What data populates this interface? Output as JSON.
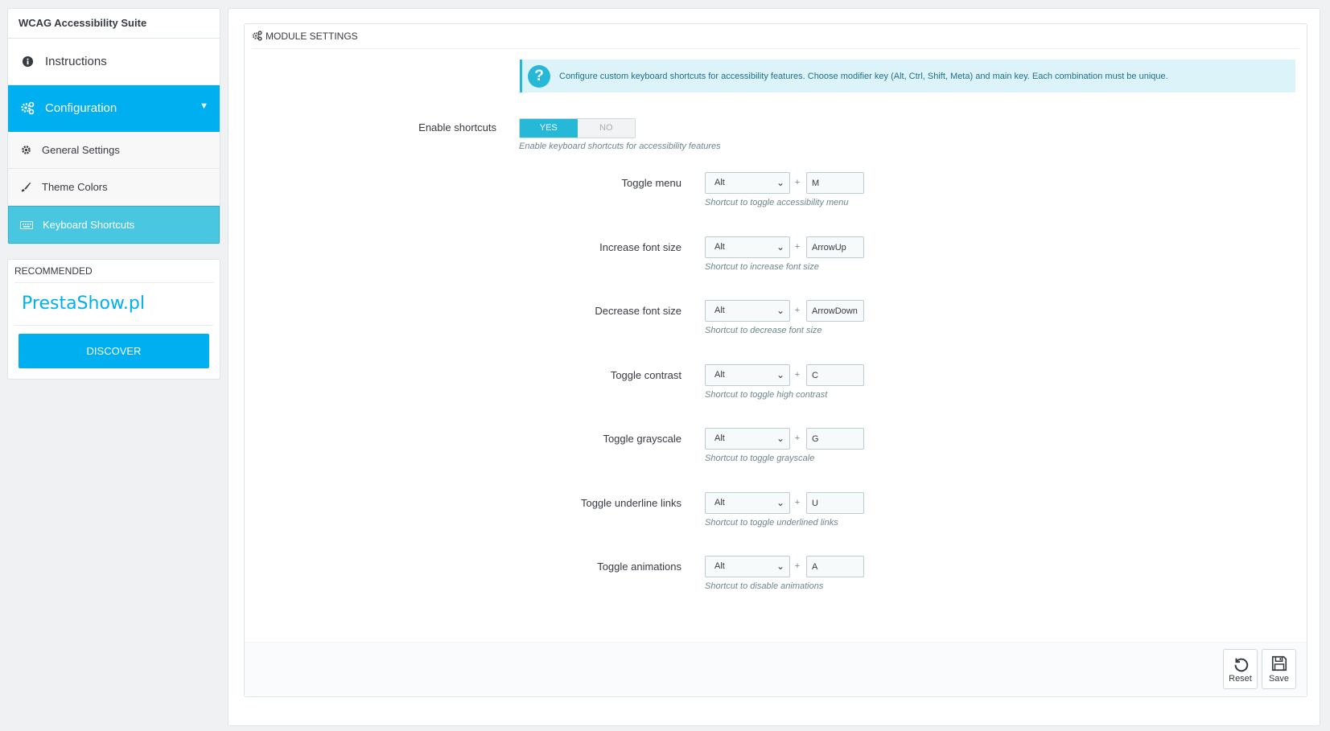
{
  "sidebar": {
    "title": "WCAG Accessibility Suite",
    "items": [
      {
        "label": "Instructions",
        "icon": "info-circle-icon"
      },
      {
        "label": "Configuration",
        "icon": "cogs-icon",
        "caret": "▼"
      }
    ],
    "subitems": [
      {
        "label": "General Settings",
        "icon": "gear-icon"
      },
      {
        "label": "Theme Colors",
        "icon": "brush-icon"
      },
      {
        "label": "Keyboard Shortcuts",
        "icon": "keyboard-icon"
      }
    ]
  },
  "recommended": {
    "title": "RECOMMENDED",
    "brand": "PrestaShow.pl",
    "button": "DISCOVER"
  },
  "panel": {
    "title": "MODULE SETTINGS",
    "info": "Configure custom keyboard shortcuts for accessibility features. Choose modifier key (Alt, Ctrl, Shift, Meta) and main key. Each combination must be unique.",
    "enable": {
      "label": "Enable shortcuts",
      "yes": "YES",
      "no": "NO",
      "value": "YES",
      "help": "Enable keyboard shortcuts for accessibility features"
    },
    "plus_sign": "+",
    "shortcuts": [
      {
        "label": "Toggle menu",
        "modifier": "Alt",
        "key": "M",
        "help": "Shortcut to toggle accessibility menu"
      },
      {
        "label": "Increase font size",
        "modifier": "Alt",
        "key": "ArrowUp",
        "help": "Shortcut to increase font size"
      },
      {
        "label": "Decrease font size",
        "modifier": "Alt",
        "key": "ArrowDown",
        "help": "Shortcut to decrease font size"
      },
      {
        "label": "Toggle contrast",
        "modifier": "Alt",
        "key": "C",
        "help": "Shortcut to toggle high contrast"
      },
      {
        "label": "Toggle grayscale",
        "modifier": "Alt",
        "key": "G",
        "help": "Shortcut to toggle grayscale"
      },
      {
        "label": "Toggle underline links",
        "modifier": "Alt",
        "key": "U",
        "help": "Shortcut to toggle underlined links"
      },
      {
        "label": "Toggle animations",
        "modifier": "Alt",
        "key": "A",
        "help": "Shortcut to disable animations"
      }
    ],
    "footer": {
      "reset": "Reset",
      "save": "Save"
    }
  },
  "colors": {
    "primary": "#00aff0",
    "active_sub": "#4ac7e0",
    "info_bg": "#dcf4f9",
    "toggle_on": "#25b9d7"
  }
}
